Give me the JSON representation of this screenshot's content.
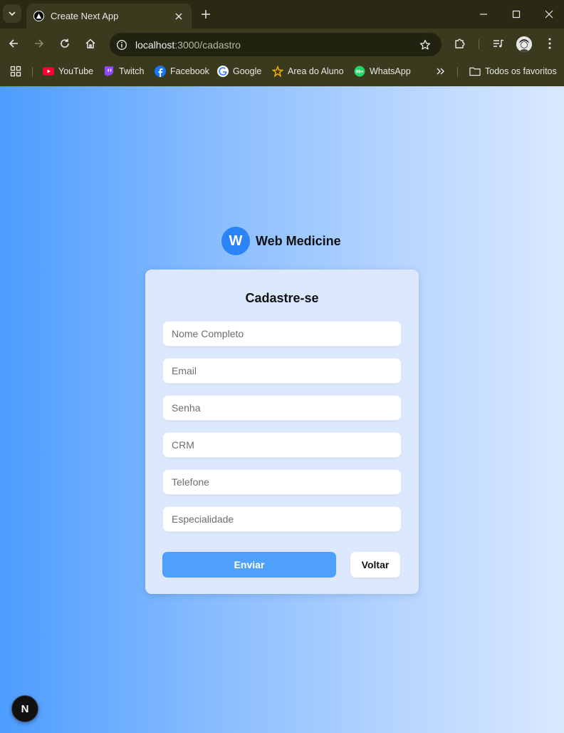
{
  "browser": {
    "tab": {
      "title": "Create Next App",
      "favicon": "nextjs-triangle-icon"
    },
    "url": {
      "host": "localhost",
      "rest": ":3000/cadastro"
    },
    "bookmarks": [
      {
        "label": "YouTube",
        "icon": "youtube-icon",
        "color": "#ff0033"
      },
      {
        "label": "Twitch",
        "icon": "twitch-icon",
        "color": "#9146ff"
      },
      {
        "label": "Facebook",
        "icon": "facebook-icon",
        "color": "#1877f2"
      },
      {
        "label": "Google",
        "icon": "google-icon",
        "color": "#4285f4"
      },
      {
        "label": "Area do Aluno",
        "icon": "star-person-icon",
        "color": "#f5b400"
      },
      {
        "label": "WhatsApp",
        "icon": "whatsapp-icon",
        "color": "#25d366"
      }
    ],
    "all_bookmarks": "Todos os favoritos"
  },
  "brand": {
    "initial": "W",
    "name": "Web Medicine",
    "color": "#2b84f5"
  },
  "form": {
    "title": "Cadastre-se",
    "fields": [
      {
        "placeholder": "Nome Completo"
      },
      {
        "placeholder": "Email"
      },
      {
        "placeholder": "Senha"
      },
      {
        "placeholder": "CRM"
      },
      {
        "placeholder": "Telefone"
      },
      {
        "placeholder": "Especialidade"
      }
    ],
    "submit_label": "Enviar",
    "back_label": "Voltar",
    "accent": "#4fa0fb"
  },
  "dev_badge": {
    "label": "N"
  }
}
